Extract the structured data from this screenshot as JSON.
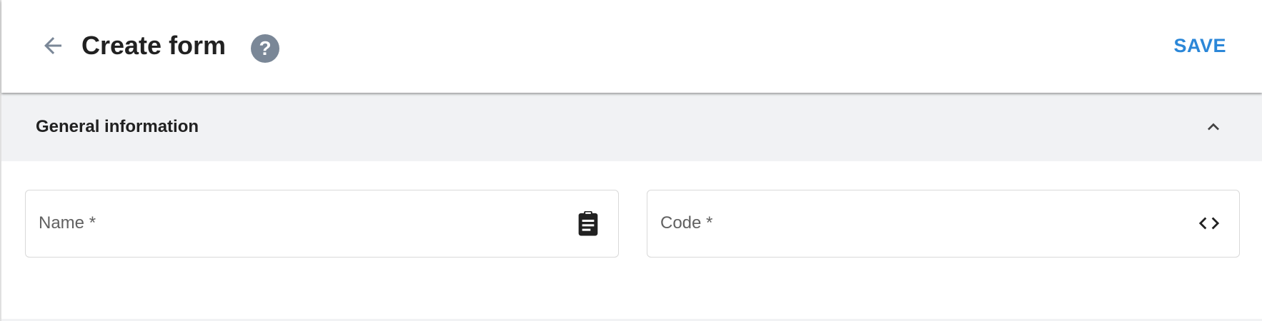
{
  "header": {
    "back_icon": "arrow-back-icon",
    "title": "Create form",
    "help_icon": "help-icon",
    "help_glyph": "?",
    "save_label": "SAVE"
  },
  "section": {
    "title": "General information",
    "toggle_icon": "chevron-up-icon",
    "expanded": true
  },
  "fields": {
    "name": {
      "label": "Name *",
      "value": "",
      "icon": "clipboard-icon"
    },
    "code": {
      "label": "Code *",
      "value": "",
      "icon": "code-icon"
    }
  },
  "colors": {
    "accent": "#2b87d8",
    "help_bg": "#7a8797",
    "section_bg": "#f1f2f4",
    "border": "#d9d9d9"
  }
}
